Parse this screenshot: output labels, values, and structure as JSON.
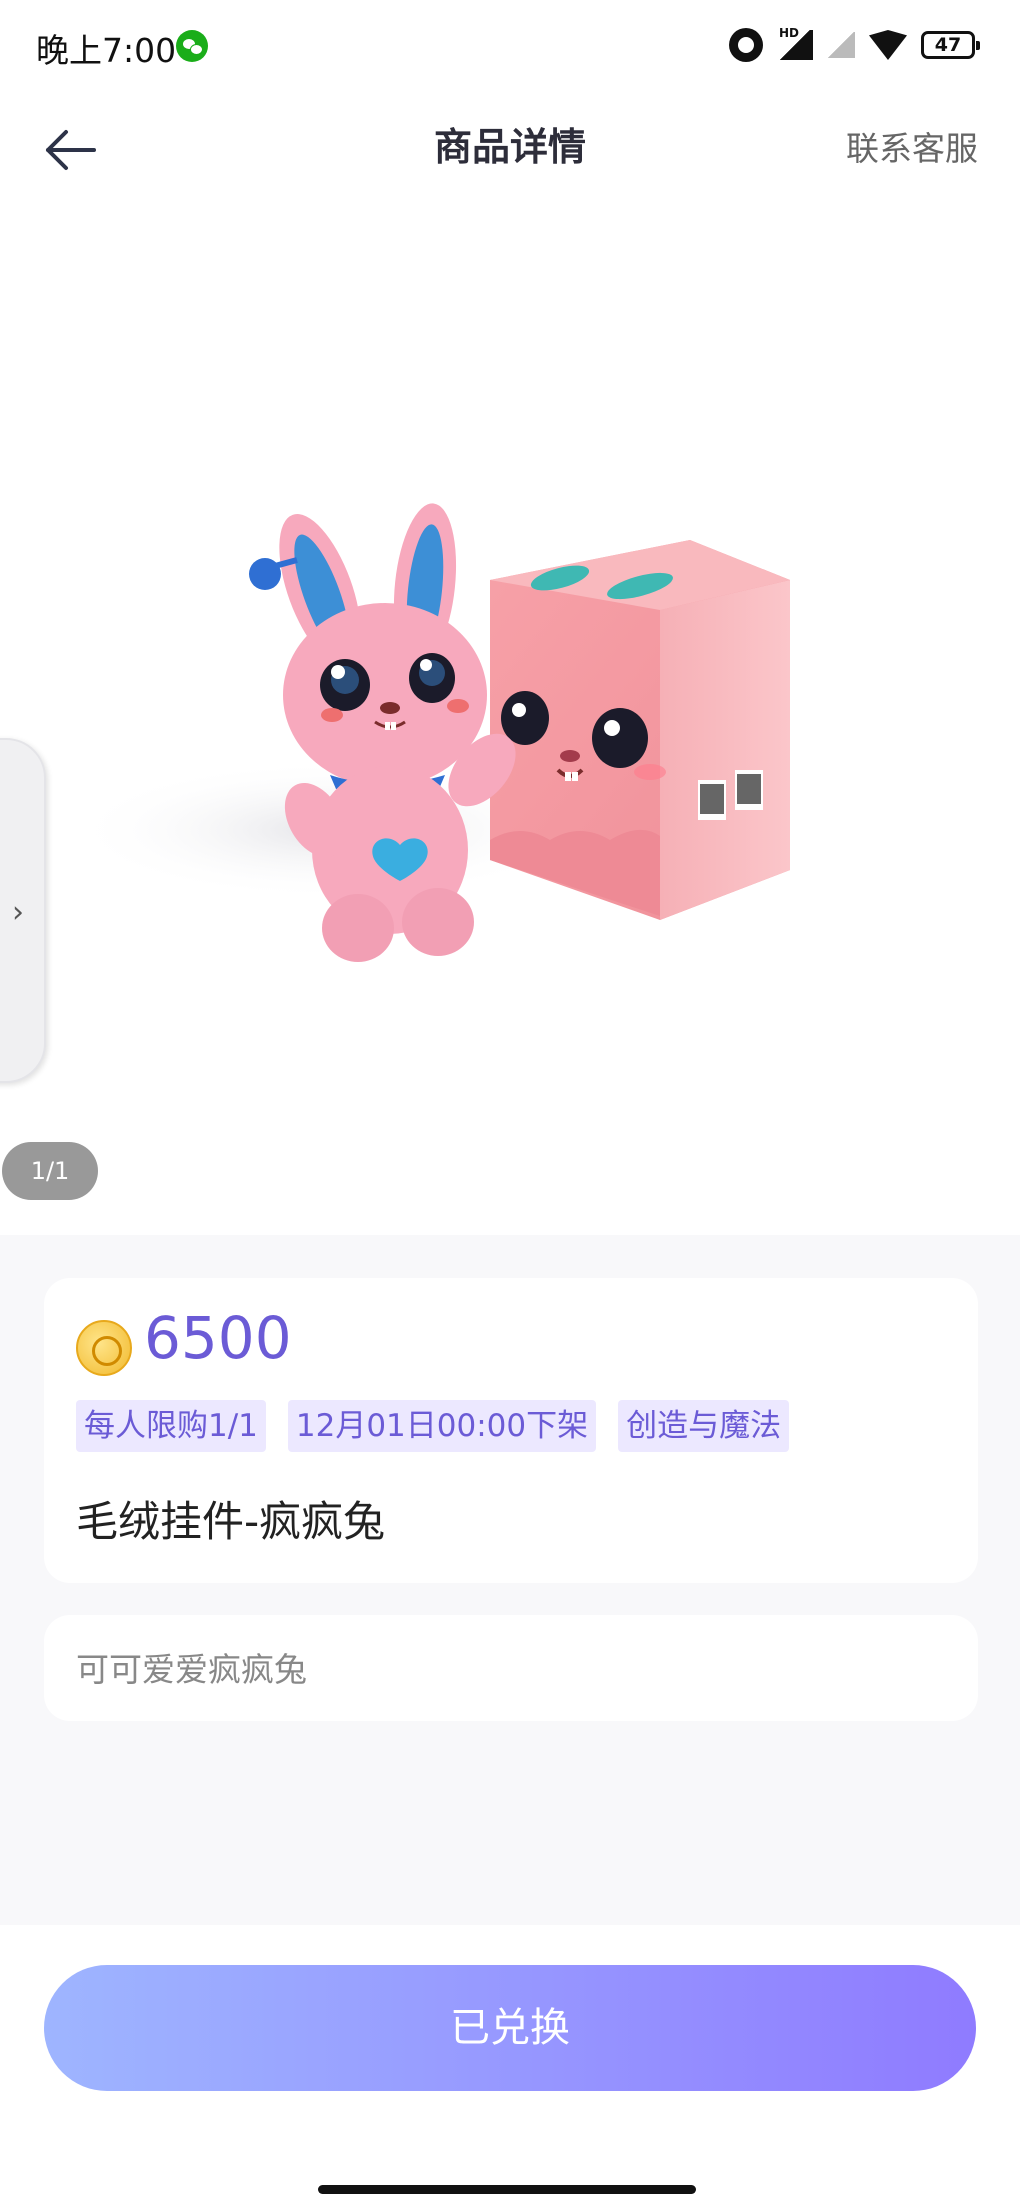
{
  "status_bar": {
    "time": "晚上7:00",
    "hd": "HD",
    "battery": "47"
  },
  "header": {
    "title": "商品详情",
    "contact": "联系客服"
  },
  "gallery": {
    "counter": "1/1"
  },
  "product": {
    "price": "6500",
    "tags": [
      "每人限购1/1",
      "12月01日00:00下架",
      "创造与魔法"
    ],
    "name": "毛绒挂件-疯疯兔",
    "description": "可可爱爱疯疯兔"
  },
  "action": {
    "button_label": "已兑换"
  },
  "colors": {
    "accent": "#6b5bd6",
    "tag_bg": "#ece8ff",
    "button_start": "#9eb5ff",
    "button_end": "#8f7bff"
  }
}
